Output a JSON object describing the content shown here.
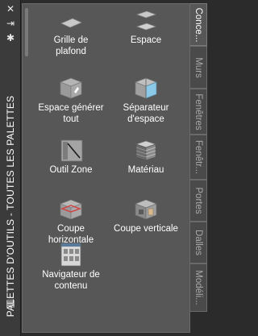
{
  "titlebar": {
    "title": "PALETTES D'OUTILS - TOUTES LES PALETTES",
    "close_glyph": "✕",
    "autohide_glyph": "⇥",
    "properties_glyph": "✱",
    "menu_glyph": "▤"
  },
  "tools": [
    {
      "label": "Grille de\nplafond",
      "icon": "ceiling-grid-icon"
    },
    {
      "label": "Espace",
      "icon": "space-icon"
    },
    {
      "label": "Espace générer\ntout",
      "icon": "space-generate-all-icon"
    },
    {
      "label": "Séparateur\nd'espace",
      "icon": "space-separator-icon"
    },
    {
      "label": "Outil Zone",
      "icon": "zone-tool-icon"
    },
    {
      "label": "Matériau",
      "icon": "material-icon"
    },
    {
      "label": "Coupe\nhorizontale",
      "icon": "horizontal-section-icon"
    },
    {
      "label": "Coupe verticale",
      "icon": "vertical-section-icon"
    },
    {
      "label": "Navigateur de\ncontenu",
      "icon": "content-browser-icon"
    }
  ],
  "tabs": [
    {
      "label": "Conce...",
      "active": true
    },
    {
      "label": "Murs",
      "active": false
    },
    {
      "label": "Fenêtres",
      "active": false
    },
    {
      "label": "Fenêtr...",
      "active": false
    },
    {
      "label": "Portes",
      "active": false
    },
    {
      "label": "Dalles",
      "active": false
    },
    {
      "label": "Modéli...",
      "active": false
    }
  ]
}
